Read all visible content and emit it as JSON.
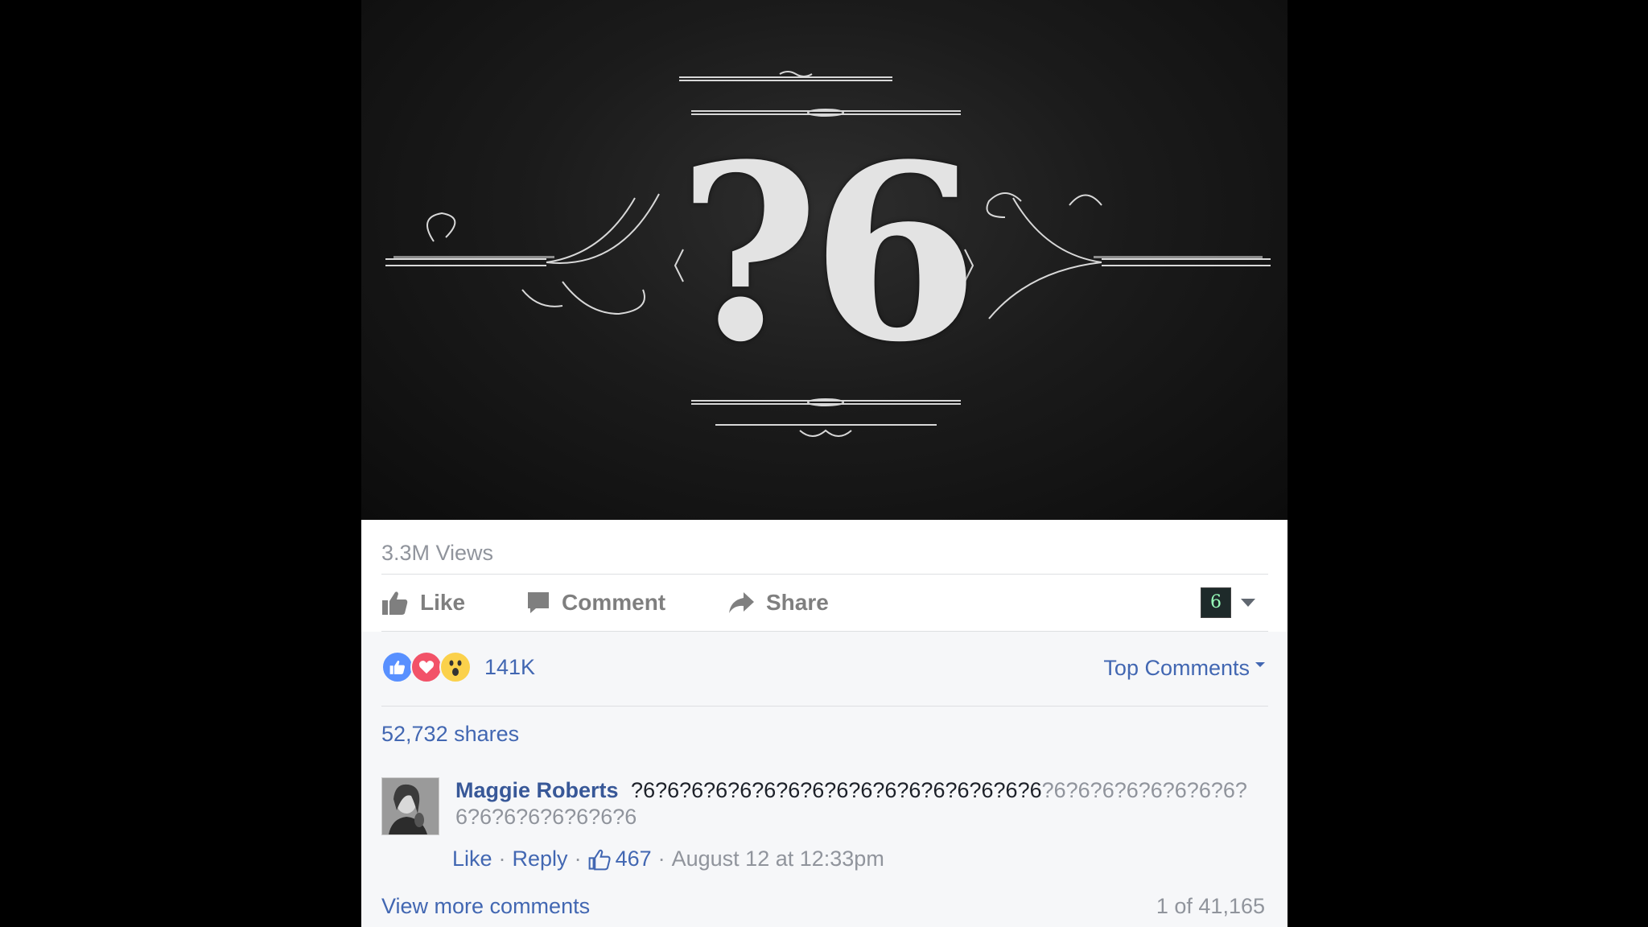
{
  "video": {
    "title_mark": "?6"
  },
  "stats": {
    "views": "3.3M Views"
  },
  "actions": {
    "like": "Like",
    "comment": "Comment",
    "share": "Share",
    "page_avatar_glyph": "6"
  },
  "reactions": {
    "count": "141K",
    "types": [
      "like",
      "love",
      "wow"
    ]
  },
  "sort": {
    "label": "Top Comments"
  },
  "shares": {
    "label": "52,732 shares"
  },
  "comment": {
    "author": "Maggie Roberts",
    "text_main": "?6?6?6?6?6?6?6?6?6?6?6?6?6?6?6?6?6",
    "text_faded": "?6?6?6?6?6?6?6?6?6?6?6?6?6?6?6?6",
    "like": "Like",
    "reply": "Reply",
    "likes_count": "467",
    "timestamp": "August 12 at 12:33pm"
  },
  "footer": {
    "view_more": "View more comments",
    "count": "1 of 41,165"
  },
  "colors": {
    "link": "#4267b2",
    "author": "#385898",
    "muted": "#90949c",
    "like_reaction": "#5890ff",
    "love_reaction": "#f25268",
    "wow_reaction": "#fbd14b"
  }
}
